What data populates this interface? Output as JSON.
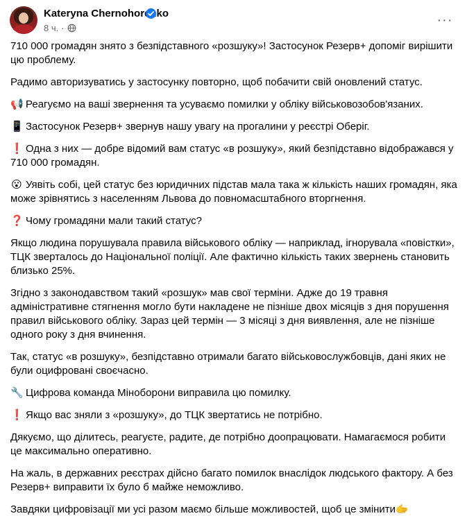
{
  "author": {
    "name": "Kateryna Chernohorenko",
    "time": "8 ч.",
    "separator": "·"
  },
  "header": {
    "more_label": "···"
  },
  "icons": {
    "verified": "verified-badge-icon",
    "audience": "globe-icon",
    "more": "more-options-icon"
  },
  "colors": {
    "verified": "#1877f2",
    "secondary_text": "#65676b",
    "text": "#050505"
  },
  "paragraphs": {
    "p1": "710 000 громадян знято з безпідставного «розшуку»! Застосунок Резерв+ допоміг вирішити цю проблему.",
    "p2": "Радимо авторизуватись у застосунку повторно, щоб побачити свій оновлений статус.",
    "p3": "Реагуємо на ваші звернення та усуваємо помилки у обліку військовозобов'язаних.",
    "p4": "Застосунок Резерв+ звернув нашу увагу на прогалини у реєстрі Оберіг.",
    "p5": "Одна з них — добре відомий вам статус «в розшуку», який безпідставно відображався у 710 000 громадян.",
    "p6": "Уявіть собі, цей статус без юридичних підстав мала така ж кількість наших громадян, яка може зрівнятись з населенням Львова до повномасштабного вторгнення.",
    "p7": "Чому громадяни мали такий статус?",
    "p8": "Якщо людина порушувала правила військового обліку — наприклад, ігнорувала «повістки», ТЦК зверталось до Національної поліції. Але фактично кількість таких звернень становить близько 25%.",
    "p9": "Згідно з законодавством такий «розшук» мав свої терміни. Адже до 19 травня адміністративне стягнення могло бути накладене не пізніше двох місяців з дня порушення правил військового обліку. Зараз цей термін — 3 місяці з дня виявлення, але не пізніше одного року з дня вчинення.",
    "p10": "Так, статус «в розшуку», безпідставно отримали багато військовослужбовців, дані яких не були оцифровані своєчасно.",
    "p11": "Цифрова команда Міноборони виправила цю помилку.",
    "p12": "Якщо вас зняли з «розшуку», до ТЦК звертатись не потрібно.",
    "p13": "Дякуємо, що ділитесь, реагуєте, радите, де потрібно доопрацювати. Намагаємося робити це максимально оперативно.",
    "p14": "На жаль, в державних реєстрах дійсно багато помилок внаслідок людського фактору. А без Резерв+ виправити їх було б майже неможливо.",
    "p15": "Завдяки цифровізації ми усі разом маємо більше можливостей, щоб це змінити"
  },
  "emoji": {
    "megaphone": "📢",
    "phone": "📱",
    "exclamation": "❗",
    "astonished": "😮",
    "question": "❓",
    "wrench": "🔧",
    "handshake": "🫱"
  }
}
